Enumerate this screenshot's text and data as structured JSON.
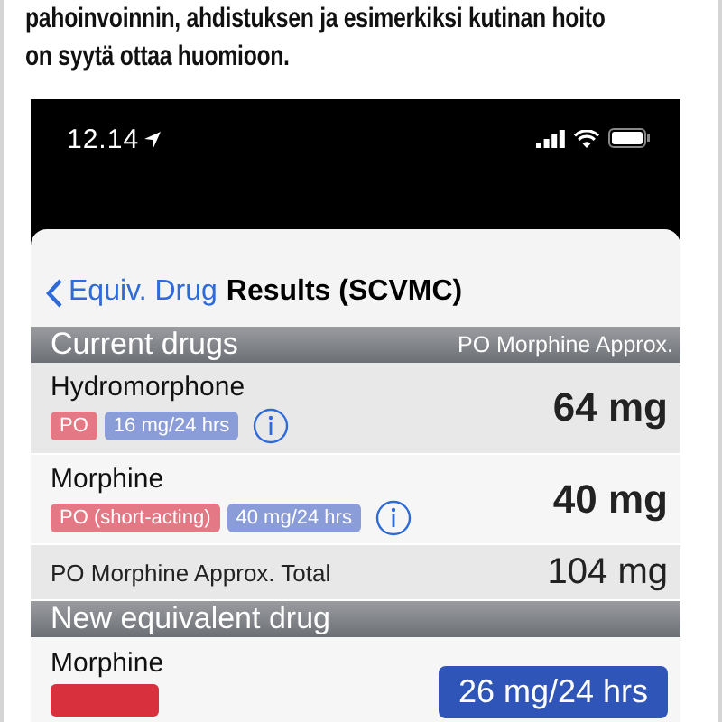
{
  "article": {
    "lines": [
      "pahoinvoinnin, ahdistuksen ja esimerkiksi kutinan hoito",
      "on syytä ottaa huomioon."
    ]
  },
  "status_bar": {
    "time": "12.14"
  },
  "nav": {
    "back_label": "Equiv. Drug",
    "title": "Results (SCVMC)"
  },
  "sections": [
    {
      "title": "Current drugs",
      "right_label": "PO Morphine Approx.",
      "rows": [
        {
          "kind": "drug",
          "name": "Hydromorphone",
          "tags": [
            {
              "kind": "route",
              "text": "PO"
            },
            {
              "kind": "dose",
              "text": "16 mg/24 hrs"
            }
          ],
          "info": true,
          "value": "64 mg",
          "shade": true
        },
        {
          "kind": "drug",
          "name": "Morphine",
          "tags": [
            {
              "kind": "route",
              "text": "PO (short-acting)"
            },
            {
              "kind": "dose",
              "text": "40 mg/24 hrs"
            }
          ],
          "info": true,
          "value": "40 mg",
          "shade": false
        },
        {
          "kind": "total",
          "label": "PO Morphine Approx. Total",
          "value": "104 mg",
          "shade": true
        }
      ]
    },
    {
      "title": "New equivalent drug",
      "rows": [
        {
          "kind": "result",
          "name": "Morphine",
          "tags": [
            {
              "kind": "strong-route"
            }
          ],
          "value": "26 mg/24 hrs",
          "shade": false
        }
      ]
    }
  ]
}
